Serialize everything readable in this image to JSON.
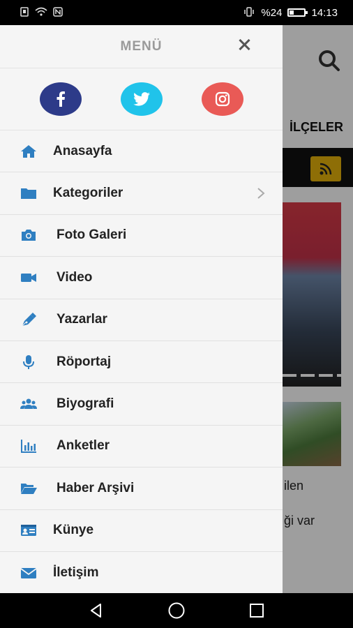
{
  "status_bar": {
    "battery_percent": "%24",
    "time": "14:13"
  },
  "background_app": {
    "nav_visible_text": "İLÇELER",
    "snippet_1": "ilen",
    "snippet_2": "ği var"
  },
  "drawer": {
    "title": "MENÜ",
    "social": [
      {
        "name": "facebook",
        "icon": "facebook-icon",
        "color": "#2d3b89"
      },
      {
        "name": "twitter",
        "icon": "twitter-icon",
        "color": "#20c3ea"
      },
      {
        "name": "instagram",
        "icon": "instagram-icon",
        "color": "#e95a56"
      }
    ],
    "items": [
      {
        "label": "Anasayfa",
        "icon": "home-icon"
      },
      {
        "label": "Kategoriler",
        "icon": "folder-icon",
        "has_submenu": true
      },
      {
        "label": "Foto Galeri",
        "icon": "camera-icon"
      },
      {
        "label": "Video",
        "icon": "video-icon"
      },
      {
        "label": "Yazarlar",
        "icon": "pen-icon"
      },
      {
        "label": "Röportaj",
        "icon": "microphone-icon"
      },
      {
        "label": "Biyografi",
        "icon": "users-icon"
      },
      {
        "label": "Anketler",
        "icon": "bar-chart-icon"
      },
      {
        "label": "Haber Arşivi",
        "icon": "folder-open-icon"
      },
      {
        "label": "Künye",
        "icon": "id-card-icon"
      },
      {
        "label": "İletişim",
        "icon": "envelope-icon"
      }
    ]
  },
  "colors": {
    "accent_icon": "#2f7fc1",
    "rss_button": "#e5b20b"
  }
}
